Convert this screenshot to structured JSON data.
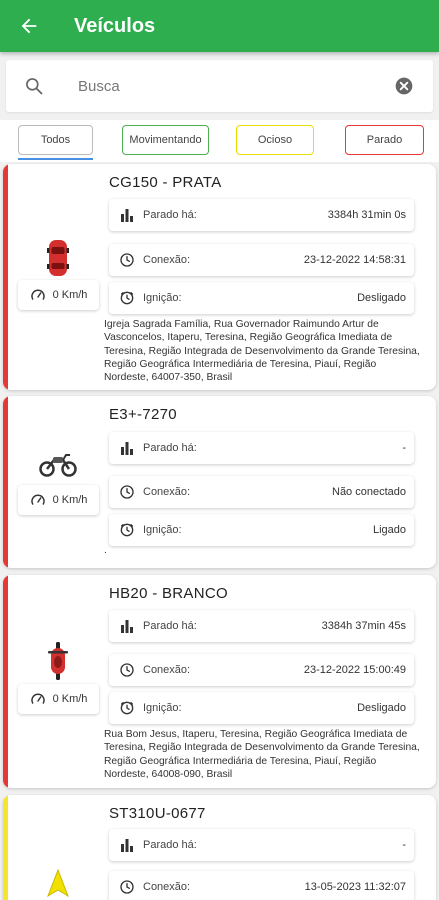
{
  "header": {
    "title": "Veículos",
    "back_icon": "arrow-left-icon"
  },
  "search": {
    "placeholder": "Busca",
    "value": ""
  },
  "filters": [
    {
      "label": "Todos",
      "color": "#bbbbbb",
      "selected": true
    },
    {
      "label": "Movimentando",
      "color": "#4caf50"
    },
    {
      "label": "Ocioso",
      "color": "#e8e000"
    },
    {
      "label": "Parado",
      "color": "#e53935"
    }
  ],
  "labels": {
    "stopped_for": "Parado há:",
    "connection": "Conexão:",
    "ignition": "Ignição:"
  },
  "vehicles": [
    {
      "name": "CG150 - PRATA",
      "status_color": "#e53935",
      "icon": "car-icon",
      "speed": "0 Km/h",
      "stopped_for": "3384h 31min 0s",
      "connection": "23-12-2022 14:58:31",
      "ignition": "Desligado",
      "address": "Igreja Sagrada Família, Rua Governador Raimundo Artur de Vasconcelos, Itaperu, Teresina, Região Geográfica Imediata de Teresina, Região Integrada de Desenvolvimento da Grande Teresina, Região Geográfica Intermediária de Teresina, Piauí, Região Nordeste, 64007-350, Brasil"
    },
    {
      "name": "E3+-7270",
      "status_color": "#e53935",
      "icon": "motorcycle-icon",
      "speed": "0 Km/h",
      "stopped_for": "-",
      "connection": "Não conectado",
      "ignition": "Ligado",
      "address": "."
    },
    {
      "name": "HB20 - BRANCO",
      "status_color": "#e53935",
      "icon": "motorcycle-icon",
      "speed": "0 Km/h",
      "stopped_for": "3384h 37min 45s",
      "connection": "23-12-2022 15:00:49",
      "ignition": "Desligado",
      "address": "Rua Bom Jesus, Itaperu, Teresina, Região Geográfica Imediata de Teresina, Região Integrada de Desenvolvimento da Grande Teresina, Região Geográfica Intermediária de Teresina, Piauí, Região Nordeste, 64008-090, Brasil"
    },
    {
      "name": "ST310U-0677",
      "status_color": "#f5e52f",
      "icon": "navigation-arrow-icon",
      "speed": "",
      "stopped_for": "-",
      "connection": "13-05-2023 11:32:07",
      "ignition": "",
      "address": ""
    }
  ]
}
